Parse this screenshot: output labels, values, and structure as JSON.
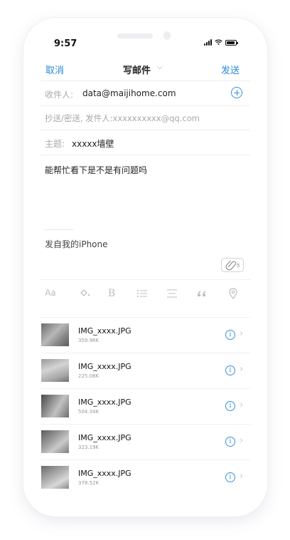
{
  "status_bar": {
    "time": "9:57"
  },
  "nav": {
    "cancel": "取消",
    "title": "写邮件",
    "chevron": "⌵",
    "send": "发送"
  },
  "fields": {
    "to_label": "收件人:",
    "to_value": "data@maijihome.com",
    "cc_text": "抄送/密送, 发件人:xxxxxxxxxx@qq.com",
    "subject_label": "主题:",
    "subject_value": "xxxxx墙壁"
  },
  "body": {
    "text": "能帮忙看下是不是有问题吗",
    "signature": "发自我的iPhone"
  },
  "attachment_badge": "5",
  "toolbar": [
    "Aa",
    "B"
  ],
  "attachments": [
    {
      "name": "IMG_xxxx.JPG",
      "size": "359.96K"
    },
    {
      "name": "IMG_xxxx.JPG",
      "size": "225.08K"
    },
    {
      "name": "IMG_xxxx.JPG",
      "size": "504.34K"
    },
    {
      "name": "IMG_xxxx.JPG",
      "size": "323.19K"
    },
    {
      "name": "IMG_xxxx.JPG",
      "size": "378.52K"
    }
  ],
  "colors": {
    "accent": "#2e88d8",
    "muted": "#aaaaaa"
  }
}
